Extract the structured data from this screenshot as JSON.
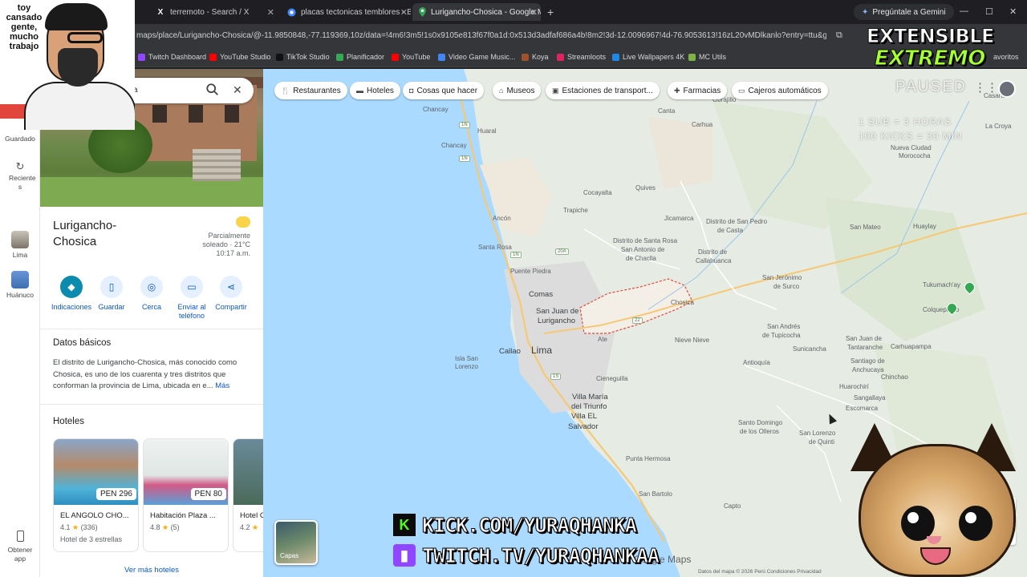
{
  "browser": {
    "tabs": [
      {
        "label": "terremoto - Search / X",
        "icon": "x-icon"
      },
      {
        "label": "placas tectonicas temblores - B",
        "icon": "chrome-icon"
      },
      {
        "label": "Lurigancho-Chosica - Google M",
        "icon": "maps-pin-icon"
      }
    ],
    "gemini_label": "Pregúntale a Gemini",
    "url": "maps/place/Lurigancho-Chosica/@-11.9850848,-77.119369,10z/data=!4m6!3m5!1s0x9105e813f67f0a1d:0x513d3adfaf686a4b!8m2!3d-12.0096967!4d-76.9053613!16zL20vMDlkanlo?entry=ttu&g_ep=Egoy...",
    "bookmarks": [
      {
        "label": "Twitch Dashboard",
        "color": "#9146ff"
      },
      {
        "label": "YouTube Studio",
        "color": "#ff0000"
      },
      {
        "label": "TikTok Studio",
        "color": "#111111"
      },
      {
        "label": "Planificador",
        "color": "#34a853"
      },
      {
        "label": "YouTube",
        "color": "#ff0000"
      },
      {
        "label": "Video Game Music...",
        "color": "#4285f4"
      },
      {
        "label": "Koya",
        "color": "#a0522d"
      },
      {
        "label": "Streamloots",
        "color": "#e0245e"
      },
      {
        "label": "Live Wallpapers 4K",
        "color": "#1e88e5"
      },
      {
        "label": "MC Utils",
        "color": "#7cb342"
      }
    ],
    "bookmarks_right": "avoritos"
  },
  "rail": {
    "items": [
      {
        "label": "Guardado"
      },
      {
        "label": "Reciente s"
      },
      {
        "label": "Lima"
      },
      {
        "label": "Huánuco"
      },
      {
        "label": "Obtener app"
      }
    ]
  },
  "search": {
    "query_fragment": "a"
  },
  "place": {
    "title": "Lurigancho-Chosica",
    "weather_line1": "Parcialmente",
    "weather_line2": "soleado · 21°C",
    "weather_line3": "10:17 a.m.",
    "actions": [
      {
        "label": "Indicaciones"
      },
      {
        "label": "Guardar"
      },
      {
        "label": "Cerca"
      },
      {
        "label": "Enviar al teléfono"
      },
      {
        "label": "Compartir"
      }
    ],
    "basics_title": "Datos básicos",
    "description": "El distrito de Lurigancho-Chosica, más conocido como Chosica, es uno de los cuarenta y tres distritos que conforman la provincia de Lima, ubicada en e...",
    "more_label": "Más",
    "hotels_title": "Hoteles",
    "hotels": [
      {
        "name": "EL ANGOLO CHO...",
        "price": "PEN 296",
        "rating": "4.1",
        "reviews": "(336)",
        "type": "Hotel de 3 estrellas"
      },
      {
        "name": "Habitación Plaza ...",
        "price": "PEN 80",
        "rating": "4.8",
        "reviews": "(5)",
        "type": ""
      },
      {
        "name": "Hotel C",
        "price": "",
        "rating": "4.2",
        "reviews": "",
        "type": ""
      }
    ],
    "see_all": "Ver más hoteles"
  },
  "map": {
    "chips": [
      {
        "label": "Restaurantes",
        "icon": "fork-knife-icon"
      },
      {
        "label": "Hoteles",
        "icon": "bed-icon"
      },
      {
        "label": "Cosas que hacer",
        "icon": "camera-icon"
      },
      {
        "label": "Museos",
        "icon": "museum-icon"
      },
      {
        "label": "Estaciones de transport...",
        "icon": "transit-icon"
      },
      {
        "label": "Farmacias",
        "icon": "pharmacy-icon"
      },
      {
        "label": "Cajeros automáticos",
        "icon": "atm-icon"
      }
    ],
    "places": [
      "Chancay",
      "Huaral",
      "Ancón",
      "Cocayalta",
      "Quives",
      "Trapiche",
      "Jicamarca",
      "Santa Rosa",
      "Puente Piedra",
      "Comas",
      "San Juan de Lurigancho",
      "Chosica",
      "Callao",
      "Lima",
      "Ate",
      "Isla San Lorenzo",
      "Nieve Nieve",
      "Villa María del Triunfo",
      "Villa EL Salvador",
      "Cieneguilla",
      "Punta Hermosa",
      "San Bartolo",
      "Capto",
      "Antioquía",
      "Sunicancha",
      "Huarochirí",
      "Tukumach'ay",
      "Colquepucro",
      "Casarac",
      "Huaylay",
      "San Mateo",
      "Escomarca",
      "Chinchao",
      "Carhuapampa",
      "Distrito de San Pedro de Casta",
      "Distrito de Callahuanca",
      "Distrito de Santa Rosa de Quives",
      "San Antonio de Chaclla",
      "San Jerónimo de Surco",
      "San Andrés de Tupicocha",
      "San Juan de Tantaranche",
      "Santiago de Anchucaya",
      "Sangallaya",
      "Santo Domingo de los Olleros",
      "San Lorenzo de Quinti",
      "Nueva Ciudad Morococha",
      "La Croya",
      "Canta",
      "Carhua",
      "Obrajillo"
    ],
    "layers_label": "Capas",
    "footer": "Datos del mapa © 2026    Perú    Condiciones    Privacidad",
    "logo_text": "Google Maps"
  },
  "overlay": {
    "caption": "toy cansado gente, mucho trabajo",
    "badge_line1": "EXTENSIBLE",
    "badge_line2": "EXTREMO",
    "status": "PAUSED",
    "rule1": "1 SUB = 3 HORAS",
    "rule2": "100 KICKS = 30 MIN",
    "kick": "KICK.COM/YURAQHANKA",
    "twitch": "TWITCH.TV/YURAQHANKAA"
  }
}
